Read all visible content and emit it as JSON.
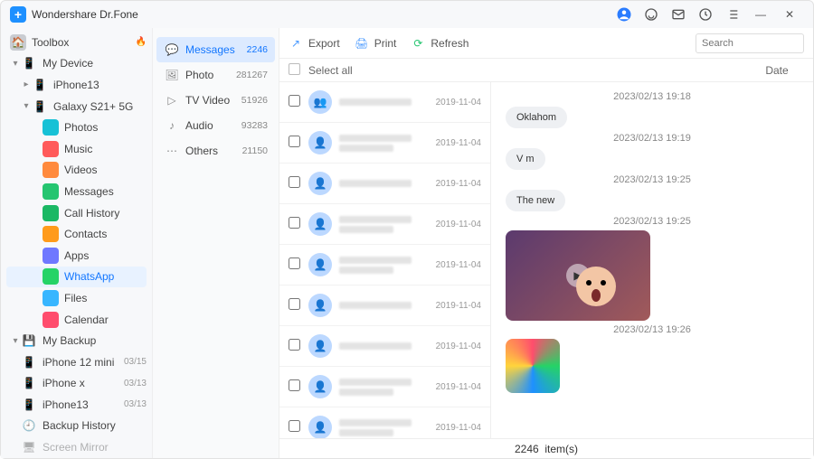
{
  "title": "Wondershare Dr.Fone",
  "sidebar": {
    "toolbox": "Toolbox",
    "my_device": "My Device",
    "devices": [
      {
        "name": "iPhone13"
      },
      {
        "name": "Galaxy S21+ 5G"
      }
    ],
    "sub": {
      "photos": "Photos",
      "music": "Music",
      "videos": "Videos",
      "messages": "Messages",
      "call_history": "Call History",
      "contacts": "Contacts",
      "apps": "Apps",
      "whatsapp": "WhatsApp",
      "files": "Files",
      "calendar": "Calendar"
    },
    "my_backup": "My Backup",
    "backups": [
      {
        "name": "iPhone 12 mini",
        "date": "03/15"
      },
      {
        "name": "iPhone x",
        "date": "03/13"
      },
      {
        "name": "iPhone13",
        "date": "03/13"
      }
    ],
    "backup_history": "Backup History",
    "screen_mirror": "Screen Mirror"
  },
  "categories": [
    {
      "label": "Messages",
      "count": "2246"
    },
    {
      "label": "Photo",
      "count": "281267"
    },
    {
      "label": "TV Video",
      "count": "51926"
    },
    {
      "label": "Audio",
      "count": "93283"
    },
    {
      "label": "Others",
      "count": "21150"
    }
  ],
  "toolbar": {
    "export": "Export",
    "print": "Print",
    "refresh": "Refresh"
  },
  "search": {
    "placeholder": "Search"
  },
  "listhead": {
    "select_all": "Select all",
    "date": "Date"
  },
  "rows": [
    {
      "date": "2019-11-04"
    },
    {
      "date": "2019-11-04"
    },
    {
      "date": "2019-11-04"
    },
    {
      "date": "2019-11-04"
    },
    {
      "date": "2019-11-04"
    },
    {
      "date": "2019-11-04"
    },
    {
      "date": "2019-11-04"
    },
    {
      "date": "2019-11-04"
    },
    {
      "date": "2019-11-04"
    }
  ],
  "chat": {
    "ts1": "2023/02/13 19:18",
    "b1": "Oklahom",
    "ts2": "2023/02/13 19:19",
    "b2": "V m",
    "ts3": "2023/02/13 19:25",
    "b3": "The new",
    "ts4": "2023/02/13 19:25",
    "ts5": "2023/02/13 19:26"
  },
  "footer": {
    "count": "2246",
    "label": "item(s)"
  }
}
